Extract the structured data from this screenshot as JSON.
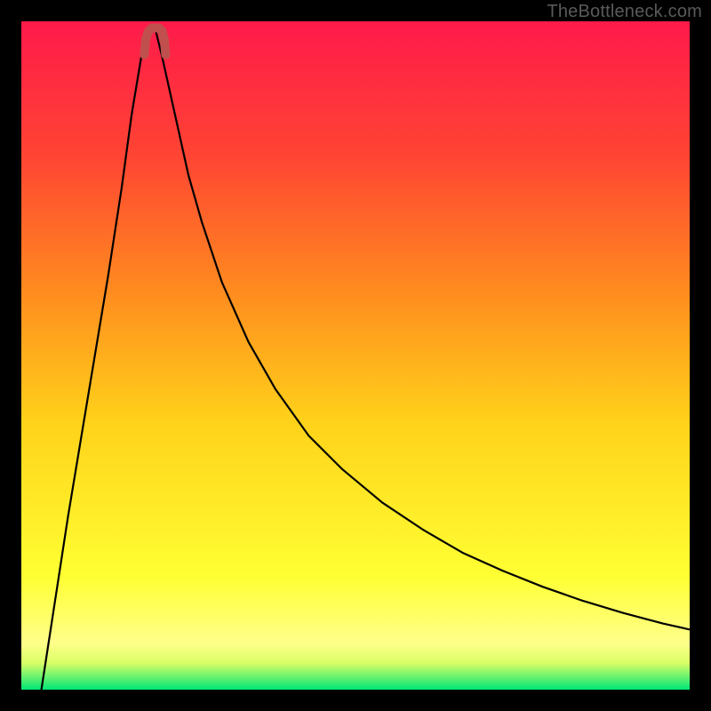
{
  "watermark": "TheBottleneck.com",
  "chart_data": {
    "type": "line",
    "title": "",
    "xlabel": "",
    "ylabel": "",
    "xlim": [
      0,
      100
    ],
    "ylim": [
      0,
      100
    ],
    "grid": false,
    "legend": false,
    "background_gradient": {
      "stops": [
        {
          "y": 0,
          "color": "#ff1a4b"
        },
        {
          "y": 20,
          "color": "#ff4433"
        },
        {
          "y": 40,
          "color": "#ff8a1f"
        },
        {
          "y": 60,
          "color": "#ffd21a"
        },
        {
          "y": 83,
          "color": "#ffff33"
        },
        {
          "y": 93,
          "color": "#ffff8a"
        },
        {
          "y": 96,
          "color": "#d9ff66"
        },
        {
          "y": 100,
          "color": "#00e676"
        }
      ]
    },
    "series": [
      {
        "name": "bottleneck-curve",
        "color": "#000000",
        "width": 2.2,
        "x": [
          3,
          5,
          7,
          9,
          11,
          13,
          15,
          16.5,
          18,
          19,
          20,
          21,
          23,
          25,
          27,
          30,
          34,
          38,
          43,
          48,
          54,
          60,
          66,
          72,
          78,
          84,
          90,
          96,
          100
        ],
        "y": [
          0,
          13,
          26,
          38,
          50,
          62,
          75,
          86,
          95,
          99,
          99,
          95,
          86,
          77,
          70,
          61,
          52,
          45,
          38,
          33,
          28,
          24,
          20.5,
          17.8,
          15.4,
          13.3,
          11.5,
          9.9,
          9
        ]
      },
      {
        "name": "marker",
        "color": "#c0504d",
        "width": 10,
        "cap": "round",
        "x": [
          18.4,
          18.6,
          19.0,
          19.5,
          20.0,
          20.6,
          21.1,
          21.4,
          21.6
        ],
        "y": [
          95.0,
          97.2,
          98.5,
          99.0,
          99.0,
          99.0,
          98.5,
          97.2,
          95.0
        ]
      }
    ]
  }
}
